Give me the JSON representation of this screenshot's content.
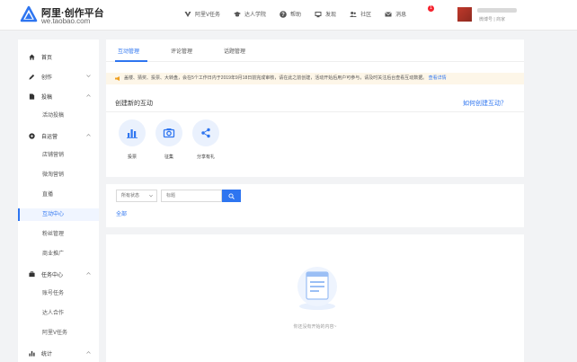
{
  "header": {
    "brand_title": "阿里·创作平台",
    "brand_url": "we.taobao.com",
    "nav": [
      {
        "label": "阿里V任务",
        "icon": "v-task-icon"
      },
      {
        "label": "达人学院",
        "icon": "graduation-cap-icon"
      },
      {
        "label": "帮助",
        "icon": "help-icon"
      },
      {
        "label": "发现",
        "icon": "discover-icon"
      },
      {
        "label": "社区",
        "icon": "community-icon"
      },
      {
        "label": "消息",
        "icon": "mail-icon"
      }
    ],
    "message_badge": "1",
    "user_shop": "微博号 | 商家"
  },
  "sidebar": {
    "items": [
      {
        "label": "首页",
        "icon": "home-icon"
      },
      {
        "label": "创作",
        "icon": "pencil-icon"
      },
      {
        "label": "投稿",
        "icon": "document-icon"
      },
      {
        "label": "活动投稿"
      },
      {
        "label": "自运营",
        "icon": "gear-icon"
      },
      {
        "label": "店铺营销"
      },
      {
        "label": "微淘营销"
      },
      {
        "label": "直播"
      },
      {
        "label": "互动中心"
      },
      {
        "label": "粉丝管理"
      },
      {
        "label": "商业推广"
      },
      {
        "label": "任务中心",
        "icon": "briefcase-icon"
      },
      {
        "label": "账号任务"
      },
      {
        "label": "达人合作"
      },
      {
        "label": "阿里V任务"
      },
      {
        "label": "统计",
        "icon": "bar-chart-icon"
      }
    ]
  },
  "main": {
    "tabs": [
      "互动管理",
      "评论管理",
      "话题管理"
    ],
    "notice": "盖楼、猜奖、投票、大转盘，会在5个工作日内于2019年9月18日前完成审核，请在此之前创建，活动开始后用户可参与，请及时关注后台查看互动数据。",
    "notice_link": "查看详情",
    "create_title": "创建新的互动",
    "how_link": "如何创建互动？",
    "interaction_types": [
      {
        "label": "投票",
        "icon": "bar-chart-icon"
      },
      {
        "label": "征集",
        "icon": "camera-icon"
      },
      {
        "label": "分享有礼",
        "icon": "share-icon"
      }
    ],
    "filter": {
      "status_select": "所有状态",
      "search_placeholder": "标题",
      "all_link": "全部"
    },
    "empty_text": "你还没有开始的内容~"
  },
  "colors": {
    "accent": "#2e75f0",
    "notice_bg": "#fdf6e8",
    "badge": "#f5222d"
  }
}
